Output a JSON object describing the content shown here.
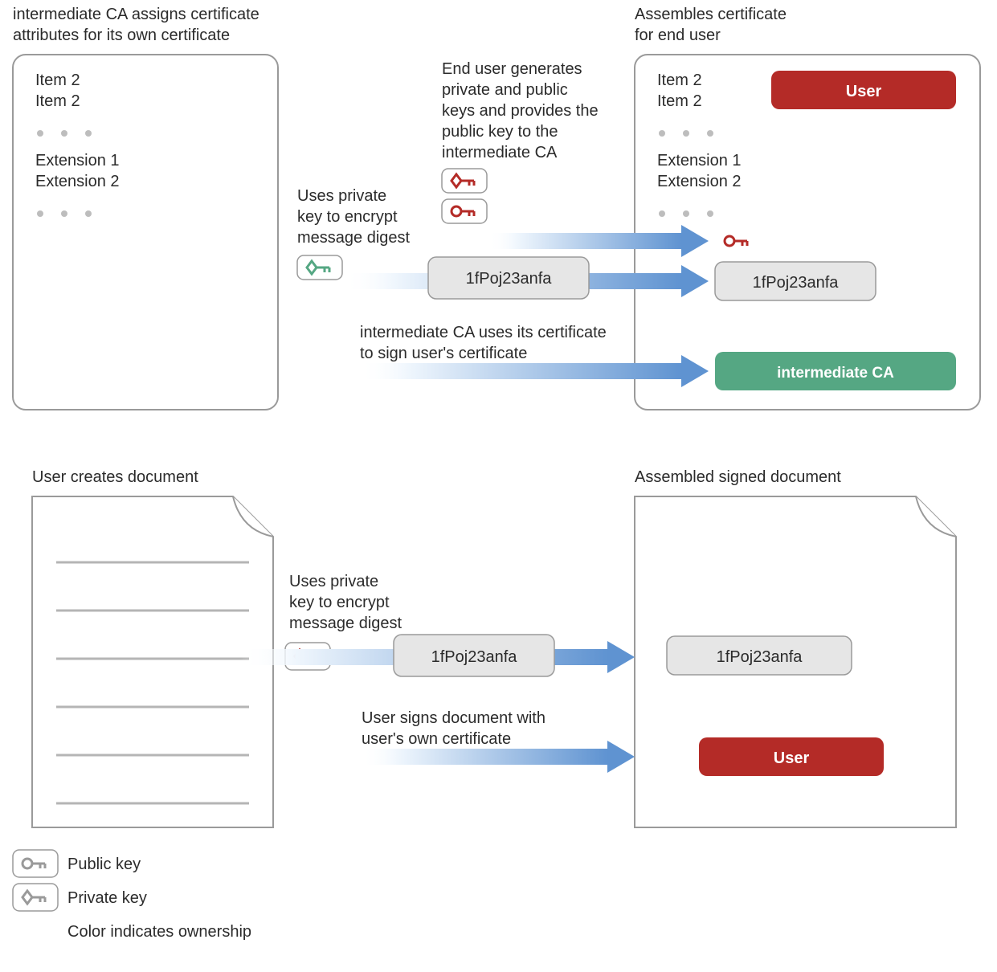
{
  "top": {
    "left_title_l1": "intermediate CA assigns certificate",
    "left_title_l2": "attributes for its own certificate",
    "right_title_l1": "Assembles certificate",
    "right_title_l2": "for end user",
    "item_a": "Item 2",
    "item_b": "Item 2",
    "ext_a": "Extension 1",
    "ext_b": "Extension 2",
    "uses_private_l1": "Uses private",
    "uses_private_l2": "key to encrypt",
    "uses_private_l3": "message digest",
    "enduser_l1": "End user generates",
    "enduser_l2": "private and public",
    "enduser_l3": "keys and provides the",
    "enduser_l4": "public key to the",
    "enduser_l5": "intermediate CA",
    "ica_uses_l1": "intermediate CA uses its certificate",
    "ica_uses_l2": "to sign user's certificate",
    "digest": "1fPoj23anfa",
    "user_badge": "User",
    "ica_badge": "intermediate CA"
  },
  "bottom": {
    "left_title": "User creates document",
    "right_title": "Assembled signed document",
    "uses_private_l1": "Uses private",
    "uses_private_l2": "key to encrypt",
    "uses_private_l3": "message digest",
    "signs_l1": "User signs document with",
    "signs_l2": "user's own certificate",
    "digest": "1fPoj23anfa",
    "user_badge": "User"
  },
  "legend": {
    "public": "Public key",
    "private": "Private key",
    "ownership": "Color indicates ownership"
  },
  "colors": {
    "red": "#b42b27",
    "green": "#55a783",
    "grey": "#9a9a9a",
    "arrow_dark": "#5f93d1",
    "arrow_light": "#eff6fd"
  }
}
